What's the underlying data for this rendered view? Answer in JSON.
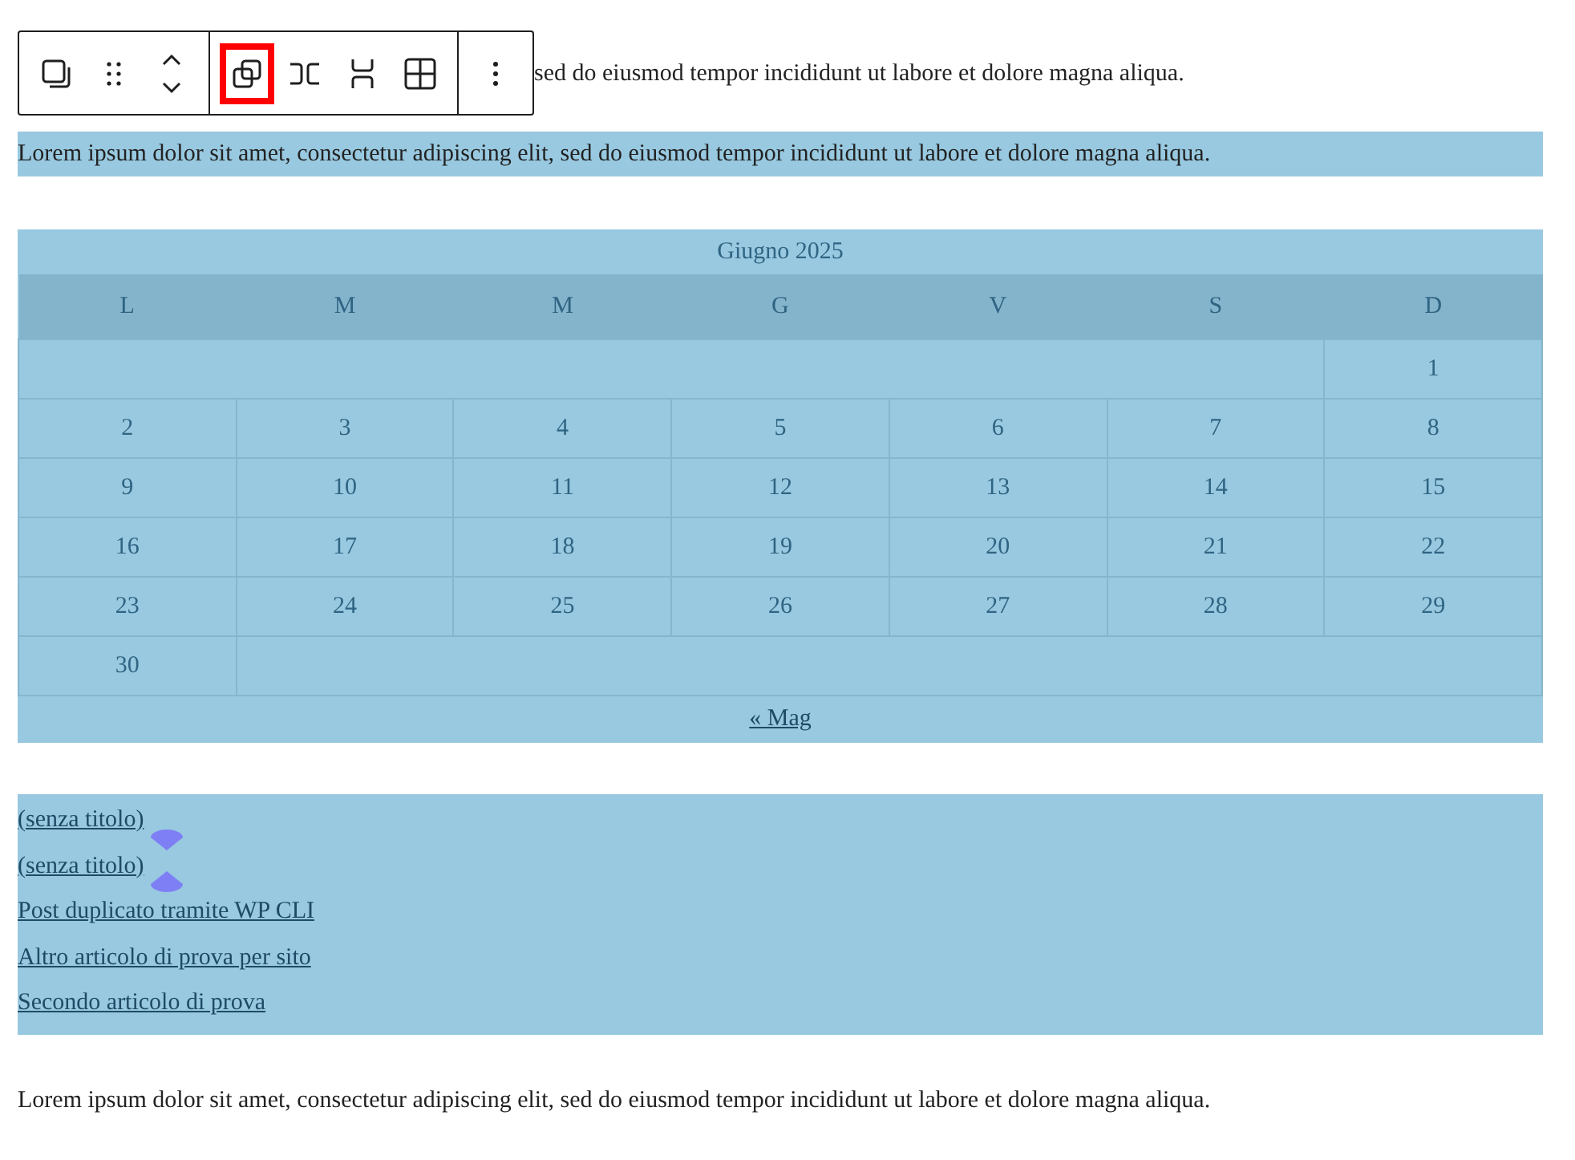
{
  "toolbar": {
    "groups": [
      {
        "buttons": [
          {
            "kind": "block",
            "selected": false
          },
          {
            "kind": "drag",
            "selected": false
          },
          {
            "kind": "move",
            "selected": false
          }
        ]
      },
      {
        "buttons": [
          {
            "kind": "duplicate",
            "selected": true
          },
          {
            "kind": "columns",
            "selected": false
          },
          {
            "kind": "rows",
            "selected": false
          },
          {
            "kind": "grid",
            "selected": false
          }
        ]
      },
      {
        "buttons": [
          {
            "kind": "more",
            "selected": false
          }
        ]
      }
    ]
  },
  "paragraphs": [
    {
      "text": "sed do eiusmod tempor incididunt ut labore et dolore magna aliqua.",
      "highlighted": false
    },
    {
      "text": "Lorem ipsum dolor sit amet, consectetur adipiscing elit, sed do eiusmod tempor incididunt ut labore et dolore magna aliqua.",
      "highlighted": true
    }
  ],
  "calendar": {
    "caption": "Giugno 2025",
    "weekdays": [
      "L",
      "M",
      "M",
      "G",
      "V",
      "S",
      "D"
    ],
    "weeks": [
      [
        "1"
      ],
      [
        "2",
        "3",
        "4",
        "5",
        "6",
        "7",
        "8"
      ],
      [
        "9",
        "10",
        "11",
        "12",
        "13",
        "14",
        "15"
      ],
      [
        "16",
        "17",
        "18",
        "19",
        "20",
        "21",
        "22"
      ],
      [
        "23",
        "24",
        "25",
        "26",
        "27",
        "28",
        "29"
      ],
      [
        "30"
      ]
    ],
    "prev_link": "« Mag"
  },
  "posts": [
    {
      "title": "(senza titolo)",
      "kind": "below"
    },
    {
      "title": "(senza titolo)",
      "kind": "above"
    },
    {
      "title": "Post duplicato tramite WP CLI",
      "kind": "plain"
    },
    {
      "title": "Altro articolo di prova per sito",
      "kind": "plain"
    },
    {
      "title": "Secondo articolo di prova",
      "kind": "plain"
    }
  ],
  "footer_paragraph": "Lorem ipsum dolor sit amet, consectetur adipiscing elit, sed do eiusmod tempor incididunt ut labore et dolore magna aliqua."
}
